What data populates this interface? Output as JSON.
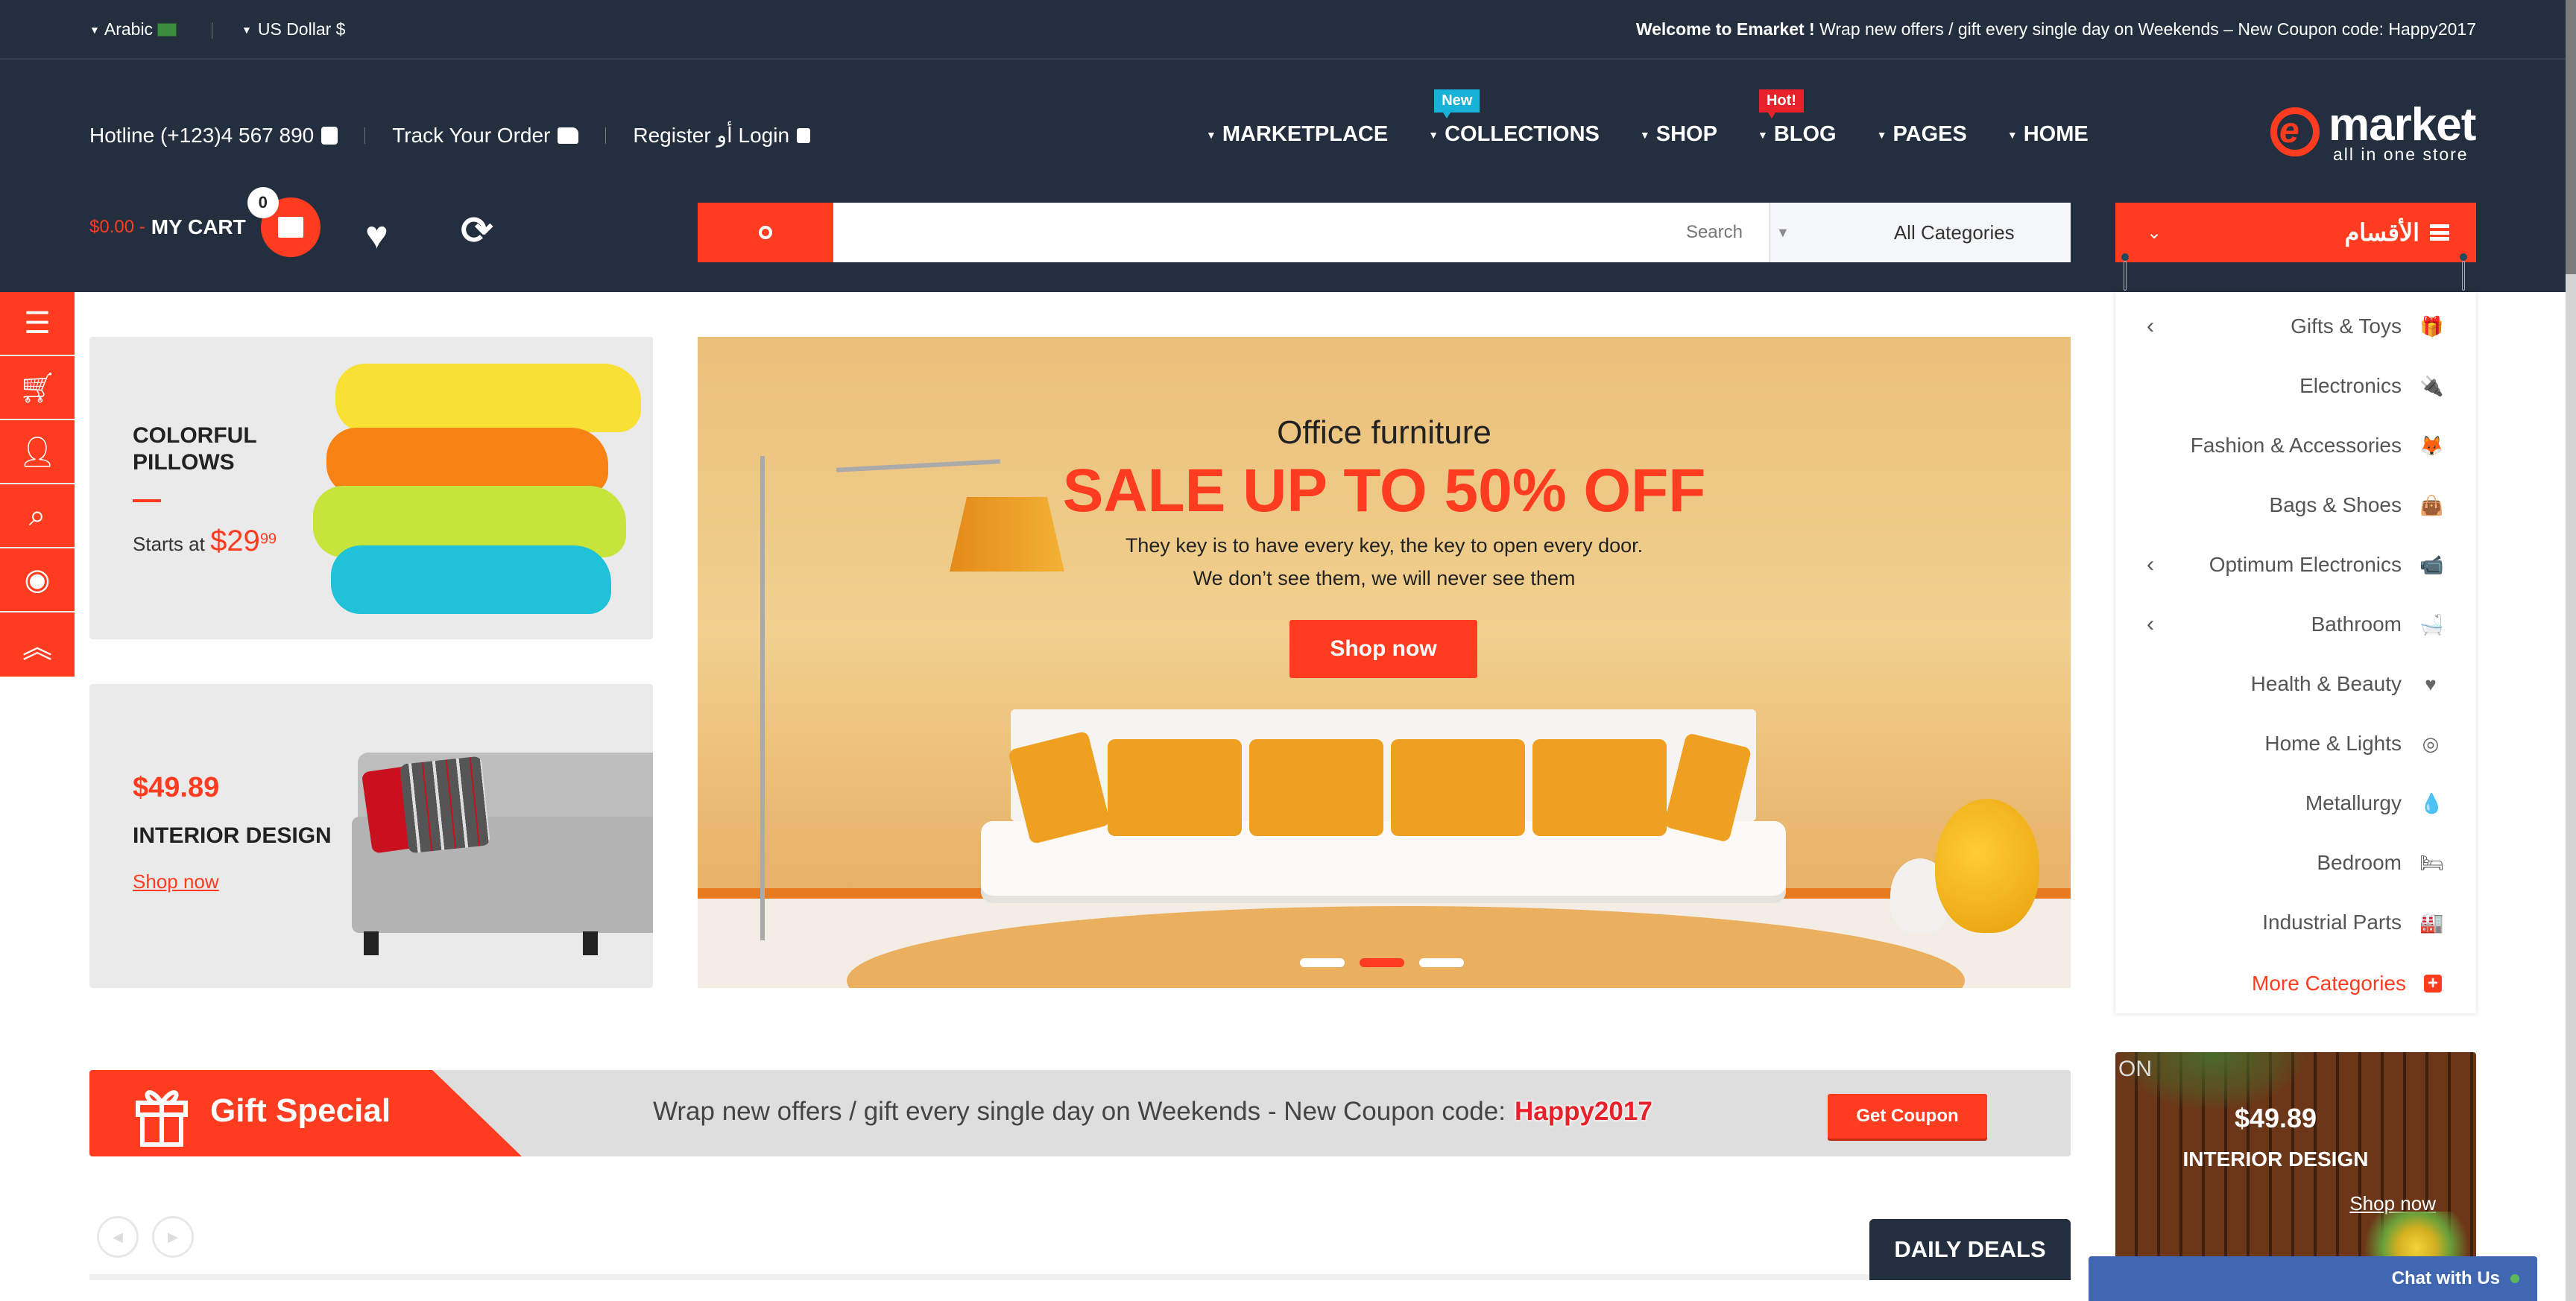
{
  "topbar": {
    "language": "Arabic",
    "currency": "US Dollar $",
    "welcome_bold": "Welcome to Emarket !",
    "welcome_text": " Wrap new offers / gift every single day on Weekends – New Coupon code: Happy2017"
  },
  "contact": {
    "hotline": "Hotline (+123)4 567 890",
    "track_order": "Track Your Order",
    "register_login": "Register أو Login"
  },
  "nav": {
    "items": [
      {
        "label": "MARKETPLACE"
      },
      {
        "label": "COLLECTIONS",
        "badge": "New"
      },
      {
        "label": "SHOP"
      },
      {
        "label": "BLOG",
        "badge": "Hot!"
      },
      {
        "label": "PAGES"
      },
      {
        "label": "HOME"
      }
    ]
  },
  "logo": {
    "letter": "e",
    "word": "market",
    "tagline": "all in one store"
  },
  "cart": {
    "total": "$0.00 -",
    "label": "MY CART",
    "count": "0"
  },
  "search": {
    "placeholder": "Search",
    "category": "All Categories"
  },
  "categories": {
    "title": "الأقسام",
    "items": [
      {
        "label": "Gifts & Toys",
        "icon": "gift-icon",
        "glyph": "🎁",
        "has_sub": true
      },
      {
        "label": "Electronics",
        "icon": "plug-icon",
        "glyph": "🔌",
        "has_sub": false
      },
      {
        "label": "Fashion & Accessories",
        "icon": "fox-icon",
        "glyph": "🦊",
        "has_sub": false
      },
      {
        "label": "Bags & Shoes",
        "icon": "shopping-bag-icon",
        "glyph": "👜",
        "has_sub": false
      },
      {
        "label": "Optimum Electronics",
        "icon": "video-camera-icon",
        "glyph": "📹",
        "has_sub": true
      },
      {
        "label": "Bathroom",
        "icon": "bathtub-icon",
        "glyph": "🛁",
        "has_sub": true
      },
      {
        "label": "Health & Beauty",
        "icon": "heartbeat-icon",
        "glyph": "♥",
        "has_sub": false
      },
      {
        "label": "Home & Lights",
        "icon": "bullseye-icon",
        "glyph": "◎",
        "has_sub": false
      },
      {
        "label": "Metallurgy",
        "icon": "tint-icon",
        "glyph": "💧",
        "has_sub": false
      },
      {
        "label": "Bedroom",
        "icon": "bed-icon",
        "glyph": "🛏",
        "has_sub": false
      },
      {
        "label": "Industrial Parts",
        "icon": "industry-icon",
        "glyph": "🏭",
        "has_sub": false
      }
    ],
    "more": "More Categories"
  },
  "promo1": {
    "title_line1": "COLORFUL",
    "title_line2": "PILLOWS",
    "starts_at": "Starts at",
    "price": "$29",
    "price_cents": "99"
  },
  "promo2": {
    "price": "$49.89",
    "title": "INTERIOR DESIGN",
    "link": "Shop now"
  },
  "hero": {
    "subtitle": "Office furniture",
    "headline": "SALE UP TO 50% OFF",
    "desc_line1": "They key is to have every key, the key to open every door.",
    "desc_line2": "We don’t see them, we will never see them",
    "cta": "Shop now",
    "slides_total": 3,
    "active_slide": 2
  },
  "right_promo": {
    "corner_text": "ON",
    "price": "$49.89",
    "title": "INTERIOR DESIGN",
    "link": "Shop now"
  },
  "gift_banner": {
    "label": "Gift Special",
    "message": "Wrap new offers / gift every single day on Weekends - New Coupon code:",
    "code": "Happy2017",
    "button": "Get Coupon"
  },
  "deals": {
    "title": "DAILY DEALS"
  },
  "chat": {
    "label": "Chat with Us"
  },
  "colors": {
    "accent": "#ff3c20",
    "header_bg": "#232f3e",
    "badge_new": "#18b2d8",
    "badge_hot": "#e8212a",
    "chat_bg": "#4267b2"
  }
}
